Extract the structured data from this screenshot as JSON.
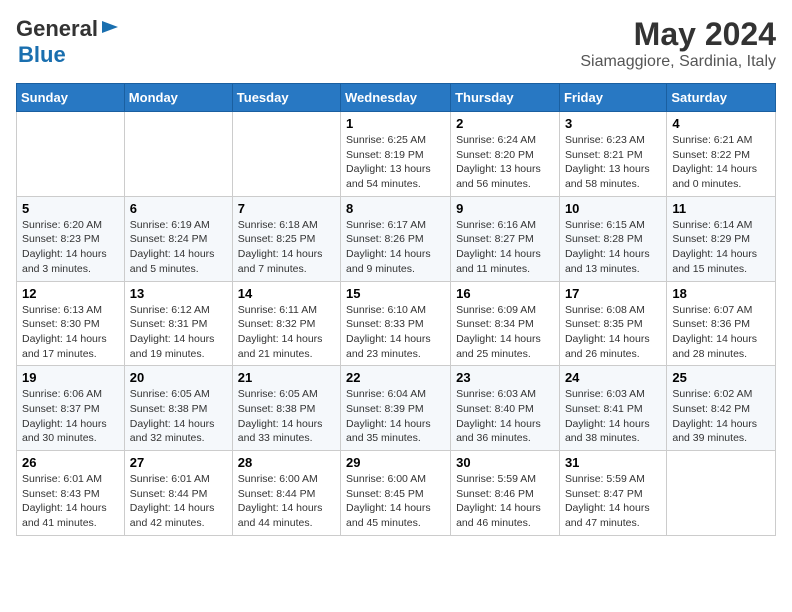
{
  "header": {
    "logo_general": "General",
    "logo_blue": "Blue",
    "month_year": "May 2024",
    "location": "Siamaggiore, Sardinia, Italy"
  },
  "weekdays": [
    "Sunday",
    "Monday",
    "Tuesday",
    "Wednesday",
    "Thursday",
    "Friday",
    "Saturday"
  ],
  "weeks": [
    [
      {
        "day": "",
        "info": ""
      },
      {
        "day": "",
        "info": ""
      },
      {
        "day": "",
        "info": ""
      },
      {
        "day": "1",
        "info": "Sunrise: 6:25 AM\nSunset: 8:19 PM\nDaylight: 13 hours\nand 54 minutes."
      },
      {
        "day": "2",
        "info": "Sunrise: 6:24 AM\nSunset: 8:20 PM\nDaylight: 13 hours\nand 56 minutes."
      },
      {
        "day": "3",
        "info": "Sunrise: 6:23 AM\nSunset: 8:21 PM\nDaylight: 13 hours\nand 58 minutes."
      },
      {
        "day": "4",
        "info": "Sunrise: 6:21 AM\nSunset: 8:22 PM\nDaylight: 14 hours\nand 0 minutes."
      }
    ],
    [
      {
        "day": "5",
        "info": "Sunrise: 6:20 AM\nSunset: 8:23 PM\nDaylight: 14 hours\nand 3 minutes."
      },
      {
        "day": "6",
        "info": "Sunrise: 6:19 AM\nSunset: 8:24 PM\nDaylight: 14 hours\nand 5 minutes."
      },
      {
        "day": "7",
        "info": "Sunrise: 6:18 AM\nSunset: 8:25 PM\nDaylight: 14 hours\nand 7 minutes."
      },
      {
        "day": "8",
        "info": "Sunrise: 6:17 AM\nSunset: 8:26 PM\nDaylight: 14 hours\nand 9 minutes."
      },
      {
        "day": "9",
        "info": "Sunrise: 6:16 AM\nSunset: 8:27 PM\nDaylight: 14 hours\nand 11 minutes."
      },
      {
        "day": "10",
        "info": "Sunrise: 6:15 AM\nSunset: 8:28 PM\nDaylight: 14 hours\nand 13 minutes."
      },
      {
        "day": "11",
        "info": "Sunrise: 6:14 AM\nSunset: 8:29 PM\nDaylight: 14 hours\nand 15 minutes."
      }
    ],
    [
      {
        "day": "12",
        "info": "Sunrise: 6:13 AM\nSunset: 8:30 PM\nDaylight: 14 hours\nand 17 minutes."
      },
      {
        "day": "13",
        "info": "Sunrise: 6:12 AM\nSunset: 8:31 PM\nDaylight: 14 hours\nand 19 minutes."
      },
      {
        "day": "14",
        "info": "Sunrise: 6:11 AM\nSunset: 8:32 PM\nDaylight: 14 hours\nand 21 minutes."
      },
      {
        "day": "15",
        "info": "Sunrise: 6:10 AM\nSunset: 8:33 PM\nDaylight: 14 hours\nand 23 minutes."
      },
      {
        "day": "16",
        "info": "Sunrise: 6:09 AM\nSunset: 8:34 PM\nDaylight: 14 hours\nand 25 minutes."
      },
      {
        "day": "17",
        "info": "Sunrise: 6:08 AM\nSunset: 8:35 PM\nDaylight: 14 hours\nand 26 minutes."
      },
      {
        "day": "18",
        "info": "Sunrise: 6:07 AM\nSunset: 8:36 PM\nDaylight: 14 hours\nand 28 minutes."
      }
    ],
    [
      {
        "day": "19",
        "info": "Sunrise: 6:06 AM\nSunset: 8:37 PM\nDaylight: 14 hours\nand 30 minutes."
      },
      {
        "day": "20",
        "info": "Sunrise: 6:05 AM\nSunset: 8:38 PM\nDaylight: 14 hours\nand 32 minutes."
      },
      {
        "day": "21",
        "info": "Sunrise: 6:05 AM\nSunset: 8:38 PM\nDaylight: 14 hours\nand 33 minutes."
      },
      {
        "day": "22",
        "info": "Sunrise: 6:04 AM\nSunset: 8:39 PM\nDaylight: 14 hours\nand 35 minutes."
      },
      {
        "day": "23",
        "info": "Sunrise: 6:03 AM\nSunset: 8:40 PM\nDaylight: 14 hours\nand 36 minutes."
      },
      {
        "day": "24",
        "info": "Sunrise: 6:03 AM\nSunset: 8:41 PM\nDaylight: 14 hours\nand 38 minutes."
      },
      {
        "day": "25",
        "info": "Sunrise: 6:02 AM\nSunset: 8:42 PM\nDaylight: 14 hours\nand 39 minutes."
      }
    ],
    [
      {
        "day": "26",
        "info": "Sunrise: 6:01 AM\nSunset: 8:43 PM\nDaylight: 14 hours\nand 41 minutes."
      },
      {
        "day": "27",
        "info": "Sunrise: 6:01 AM\nSunset: 8:44 PM\nDaylight: 14 hours\nand 42 minutes."
      },
      {
        "day": "28",
        "info": "Sunrise: 6:00 AM\nSunset: 8:44 PM\nDaylight: 14 hours\nand 44 minutes."
      },
      {
        "day": "29",
        "info": "Sunrise: 6:00 AM\nSunset: 8:45 PM\nDaylight: 14 hours\nand 45 minutes."
      },
      {
        "day": "30",
        "info": "Sunrise: 5:59 AM\nSunset: 8:46 PM\nDaylight: 14 hours\nand 46 minutes."
      },
      {
        "day": "31",
        "info": "Sunrise: 5:59 AM\nSunset: 8:47 PM\nDaylight: 14 hours\nand 47 minutes."
      },
      {
        "day": "",
        "info": ""
      }
    ]
  ]
}
